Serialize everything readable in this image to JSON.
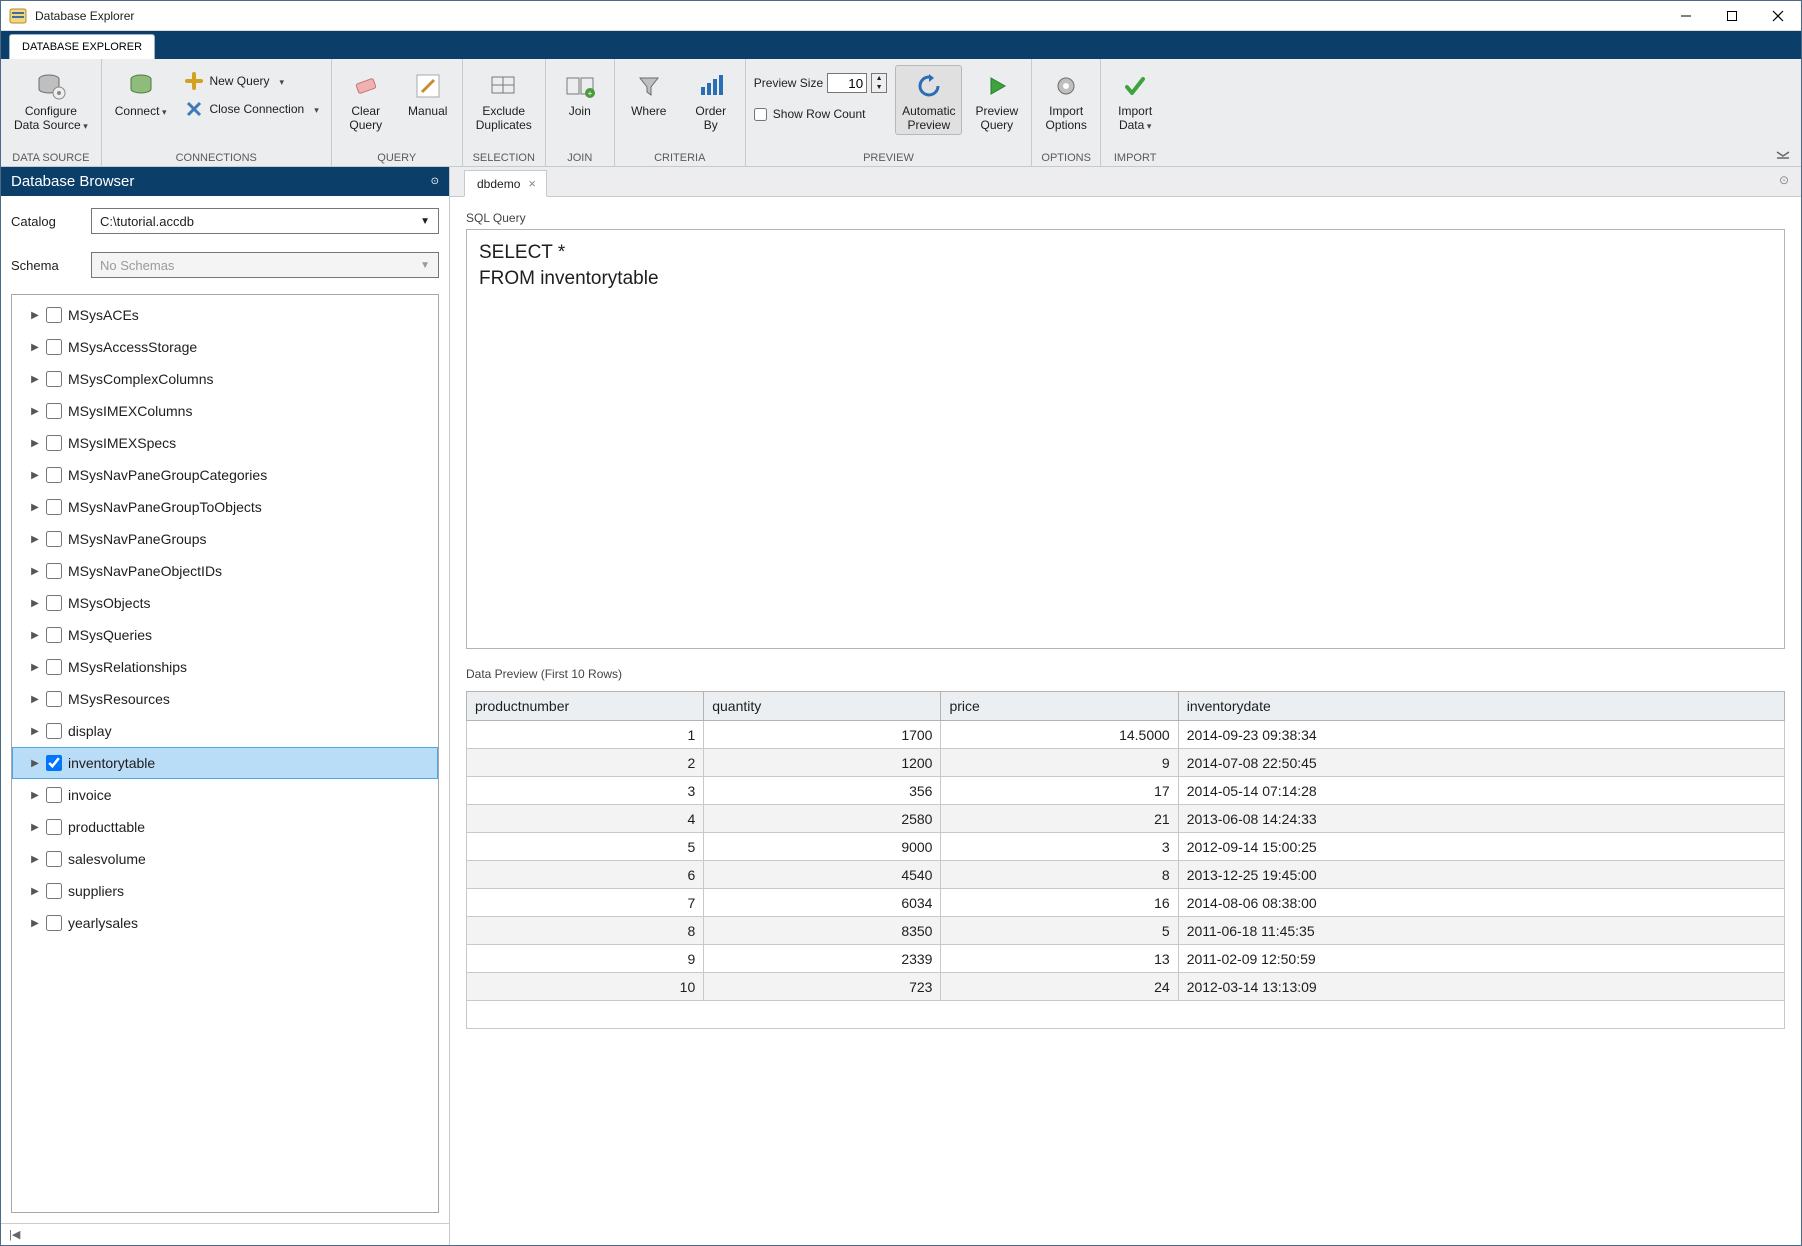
{
  "window": {
    "title": "Database Explorer"
  },
  "app_tab": "DATABASE EXPLORER",
  "ribbon": {
    "data_source": {
      "configure": "Configure\nData Source",
      "label": "DATA SOURCE"
    },
    "connections": {
      "connect": "Connect",
      "new_query": "New Query",
      "close_conn": "Close Connection",
      "label": "CONNECTIONS"
    },
    "query": {
      "clear": "Clear\nQuery",
      "manual": "Manual",
      "label": "QUERY"
    },
    "selection": {
      "exclude": "Exclude\nDuplicates",
      "label": "SELECTION"
    },
    "join": {
      "join": "Join",
      "label": "JOIN"
    },
    "criteria": {
      "where": "Where",
      "orderby": "Order\nBy",
      "label": "CRITERIA"
    },
    "preview": {
      "size_label": "Preview Size",
      "size_value": "10",
      "show_row_count": "Show Row Count",
      "automatic": "Automatic\nPreview",
      "preview_query": "Preview\nQuery",
      "label": "PREVIEW"
    },
    "options": {
      "import_options": "Import\nOptions",
      "label": "OPTIONS"
    },
    "import": {
      "import_data": "Import\nData",
      "label": "IMPORT"
    }
  },
  "browser": {
    "title": "Database Browser",
    "catalog_label": "Catalog",
    "catalog_value": "C:\\tutorial.accdb",
    "schema_label": "Schema",
    "schema_placeholder": "No Schemas",
    "tables": [
      {
        "name": "MSysACEs",
        "checked": false,
        "selected": false
      },
      {
        "name": "MSysAccessStorage",
        "checked": false,
        "selected": false
      },
      {
        "name": "MSysComplexColumns",
        "checked": false,
        "selected": false
      },
      {
        "name": "MSysIMEXColumns",
        "checked": false,
        "selected": false
      },
      {
        "name": "MSysIMEXSpecs",
        "checked": false,
        "selected": false
      },
      {
        "name": "MSysNavPaneGroupCategories",
        "checked": false,
        "selected": false
      },
      {
        "name": "MSysNavPaneGroupToObjects",
        "checked": false,
        "selected": false
      },
      {
        "name": "MSysNavPaneGroups",
        "checked": false,
        "selected": false
      },
      {
        "name": "MSysNavPaneObjectIDs",
        "checked": false,
        "selected": false
      },
      {
        "name": "MSysObjects",
        "checked": false,
        "selected": false
      },
      {
        "name": "MSysQueries",
        "checked": false,
        "selected": false
      },
      {
        "name": "MSysRelationships",
        "checked": false,
        "selected": false
      },
      {
        "name": "MSysResources",
        "checked": false,
        "selected": false
      },
      {
        "name": "display",
        "checked": false,
        "selected": false
      },
      {
        "name": "inventorytable",
        "checked": true,
        "selected": true
      },
      {
        "name": "invoice",
        "checked": false,
        "selected": false
      },
      {
        "name": "producttable",
        "checked": false,
        "selected": false
      },
      {
        "name": "salesvolume",
        "checked": false,
        "selected": false
      },
      {
        "name": "suppliers",
        "checked": false,
        "selected": false
      },
      {
        "name": "yearlysales",
        "checked": false,
        "selected": false
      }
    ]
  },
  "doc": {
    "tab_name": "dbdemo",
    "sql_label": "SQL Query",
    "sql_text": "SELECT *\nFROM inventorytable",
    "preview_label": "Data Preview (First 10 Rows)",
    "columns": [
      "productnumber",
      "quantity",
      "price",
      "inventorydate"
    ],
    "rows": [
      [
        "1",
        "1700",
        "14.5000",
        "2014-09-23 09:38:34"
      ],
      [
        "2",
        "1200",
        "9",
        "2014-07-08 22:50:45"
      ],
      [
        "3",
        "356",
        "17",
        "2014-05-14 07:14:28"
      ],
      [
        "4",
        "2580",
        "21",
        "2013-06-08 14:24:33"
      ],
      [
        "5",
        "9000",
        "3",
        "2012-09-14 15:00:25"
      ],
      [
        "6",
        "4540",
        "8",
        "2013-12-25 19:45:00"
      ],
      [
        "7",
        "6034",
        "16",
        "2014-08-06 08:38:00"
      ],
      [
        "8",
        "8350",
        "5",
        "2011-06-18 11:45:35"
      ],
      [
        "9",
        "2339",
        "13",
        "2011-02-09 12:50:59"
      ],
      [
        "10",
        "723",
        "24",
        "2012-03-14 13:13:09"
      ]
    ]
  },
  "footer_left": "|◀"
}
